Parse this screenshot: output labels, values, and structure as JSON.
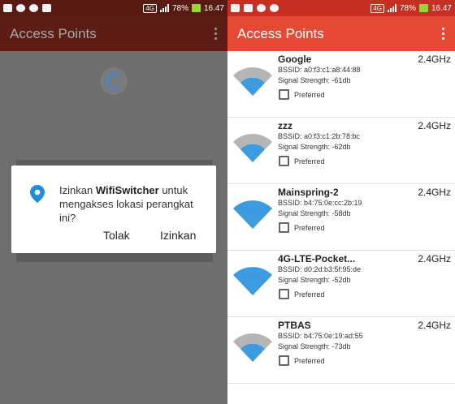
{
  "status_left_screen": {
    "network": "4G",
    "battery": "78%",
    "time": "16.47"
  },
  "status_right_screen": {
    "network": "4G",
    "battery": "78%",
    "time": "16.47"
  },
  "left_screen": {
    "title": "Access Points",
    "dialog": {
      "text_before": "Izinkan ",
      "app_name": "WifiSwitcher",
      "text_after": " untuk mengakses lokasi perangkat ini?",
      "deny_label": "Tolak",
      "allow_label": "Izinkan"
    }
  },
  "right_screen": {
    "title": "Access Points",
    "access_points": [
      {
        "ssid": "Google",
        "frequency": "2.4GHz",
        "bssid": "BSSID: a0:f3:c1:a8:44:88",
        "strength": "Signal Strength: -61db",
        "preferred_label": "Preferred",
        "signal_level": 0.5
      },
      {
        "ssid": "zzz",
        "frequency": "2.4GHz",
        "bssid": "BSSID: a0:f3:c1:2b:78:bc",
        "strength": "Signal Strength: -62db",
        "preferred_label": "Preferred",
        "signal_level": 0.5
      },
      {
        "ssid": "Mainspring-2",
        "frequency": "2.4GHz",
        "bssid": "BSSID: b4:75:0e:cc:2b:19",
        "strength": "Signal Strength: -58db",
        "preferred_label": "Preferred",
        "signal_level": 1.0
      },
      {
        "ssid": "4G-LTE-Pocket...",
        "frequency": "2.4GHz",
        "bssid": "BSSID: d0:2d:b3:5f:95:de",
        "strength": "Signal Strength: -52db",
        "preferred_label": "Preferred",
        "signal_level": 1.0
      },
      {
        "ssid": "PTBAS",
        "frequency": "2.4GHz",
        "bssid": "BSSID: b4:75:0e:19:ad:55",
        "strength": "Signal Strength: -73db",
        "preferred_label": "Preferred",
        "signal_level": 0.5
      }
    ]
  },
  "colors": {
    "accent": "#e64a35",
    "wifi_active": "#3d9be0",
    "wifi_inactive": "#b5b5b5"
  },
  "icons": [
    "whatsapp-icon",
    "image-icon",
    "location-pin-icon",
    "wifi-signal-icon",
    "overflow-menu-icon"
  ]
}
